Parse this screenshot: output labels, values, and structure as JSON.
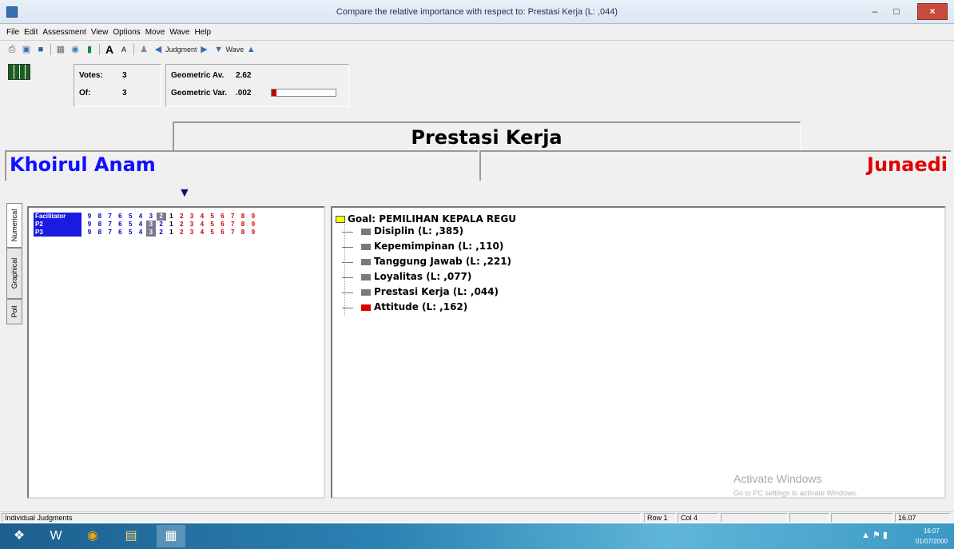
{
  "window": {
    "title": "Compare the relative importance  with respect to: Prestasi Kerja (L: ,044)",
    "minimize": "–",
    "maximize": "□",
    "close": "×"
  },
  "menu": [
    "File",
    "Edit",
    "Assessment",
    "View",
    "Options",
    "Move",
    "Wave",
    "Help"
  ],
  "toolbar": {
    "icons": [
      "print-icon",
      "print-preview-icon",
      "save-icon",
      "chart-icon",
      "globe-icon",
      "book-icon",
      "font-larger-icon",
      "font-smaller-icon",
      "people-icon"
    ],
    "judgment_label": "Judgment",
    "wave_label": "Wave"
  },
  "stats": {
    "votes_label": "Votes:",
    "votes_value": "3",
    "of_label": "Of:",
    "of_value": "3",
    "geo_av_label": "Geometric Av.",
    "geo_av_value": "2.62",
    "geo_var_label": "Geometric Var.",
    "geo_var_value": ".002",
    "geo_var_level": 0.07
  },
  "criterion": "Prestasi Kerja",
  "left_element": "Khoirul Anam",
  "right_element": "Junaedi",
  "side_tabs": [
    "Numerical",
    "Graphical",
    "Poll"
  ],
  "scale": [
    "9",
    "8",
    "7",
    "6",
    "5",
    "4",
    "3",
    "2",
    "1",
    "2",
    "3",
    "4",
    "5",
    "6",
    "7",
    "8",
    "9"
  ],
  "judgments": [
    {
      "participant": "Facilitator",
      "selected_index": 7
    },
    {
      "participant": "P2",
      "selected_index": 6
    },
    {
      "participant": "P3",
      "selected_index": 6
    }
  ],
  "tree": {
    "goal": "Goal: PEMILIHAN KEPALA REGU",
    "nodes": [
      {
        "label": "Disiplin (L: ,385)",
        "color": "#7a7a7a"
      },
      {
        "label": "Kepemimpinan (L: ,110)",
        "color": "#7a7a7a"
      },
      {
        "label": "Tanggung Jawab (L: ,221)",
        "color": "#7a7a7a"
      },
      {
        "label": "Loyalitas (L: ,077)",
        "color": "#7a7a7a"
      },
      {
        "label": "Prestasi Kerja (L: ,044)",
        "color": "#7a7a7a"
      },
      {
        "label": "Attitude (L: ,162)",
        "color": "#e00000"
      }
    ]
  },
  "watermark": {
    "line1": "Activate Windows",
    "line2": "Go to PC settings to activate Windows."
  },
  "status": {
    "left": "Individual Judgments",
    "row": "Row 1",
    "col": "Col 4",
    "time": "16.07"
  },
  "taskbar": {
    "clock_time": "16:07",
    "clock_date": "01/07/2000"
  },
  "colors": {
    "left_accent": "#1010ff",
    "right_accent": "#e00000",
    "participant_label_bg": "#1a1ae0",
    "selected_cell_bg": "#7a7a92"
  }
}
